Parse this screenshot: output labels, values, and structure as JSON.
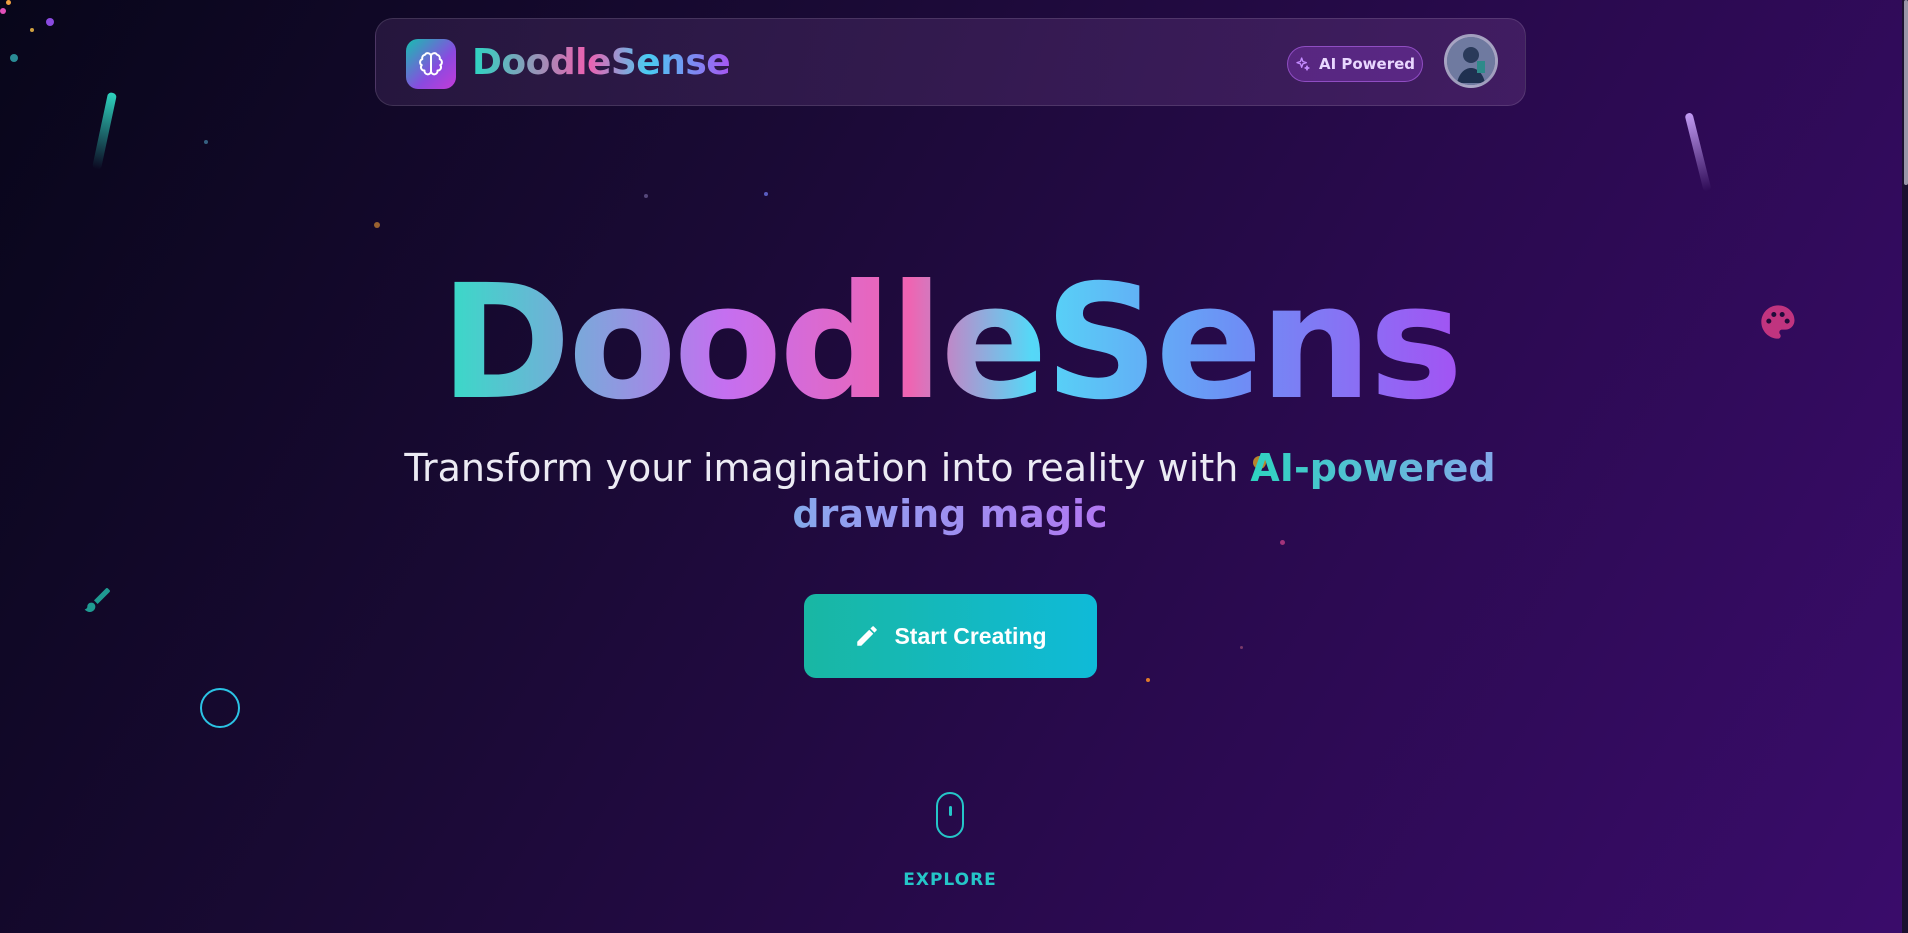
{
  "header": {
    "brand": "DoodleSense",
    "badge_label": "AI Powered",
    "logo_icon": "brain-icon",
    "badge_icon": "sparkle-icon",
    "avatar_icon": "user-avatar"
  },
  "hero": {
    "title": "DoodleSense",
    "subtitle_plain": "Transform your imagination into reality with ",
    "subtitle_highlight": "AI-powered drawing magic",
    "cta_label": "Start Creating",
    "cta_icon": "pencil-icon",
    "scroll_label": "EXPLORE",
    "scroll_icon": "mouse-icon"
  },
  "decorations": {
    "icons": [
      "palette-icon",
      "brush-icon",
      "circle-outline"
    ]
  },
  "colors": {
    "accent_teal": "#19b7a3",
    "accent_cyan": "#0fbad8",
    "accent_purple": "#a353f3",
    "accent_pink": "#ef64b2",
    "background_dark": "#08061a",
    "background_purple": "#3a0c6b"
  }
}
